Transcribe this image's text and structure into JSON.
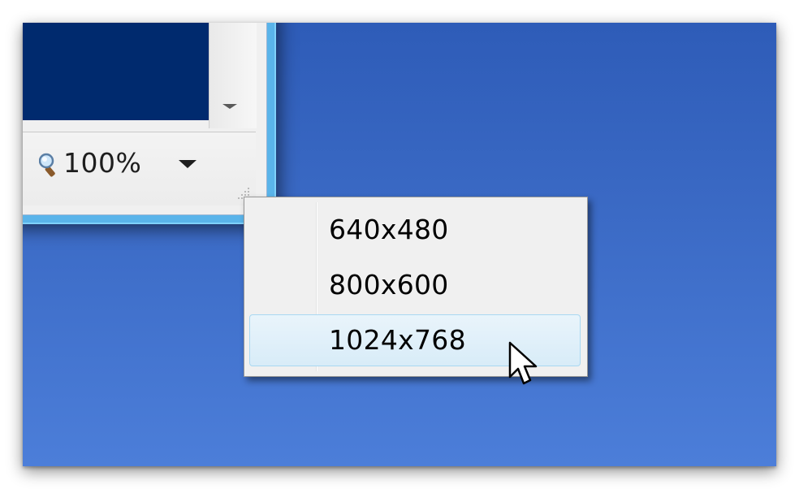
{
  "status_bar": {
    "zoom_icon": "magnifier-icon",
    "zoom_value": "100%"
  },
  "context_menu": {
    "items": [
      {
        "label": "640x480",
        "highlighted": false
      },
      {
        "label": "800x600",
        "highlighted": false
      },
      {
        "label": "1024x768",
        "highlighted": true
      }
    ]
  },
  "colors": {
    "desktop_top": "#2e5cb8",
    "desktop_bottom": "#4c7ed9",
    "preview_area": "#002a6e",
    "window_frame": "#5ab4ea",
    "menu_background": "#f0f0f0",
    "menu_highlight": "#d8ecf8"
  },
  "cursor": "arrow-pointer-icon"
}
